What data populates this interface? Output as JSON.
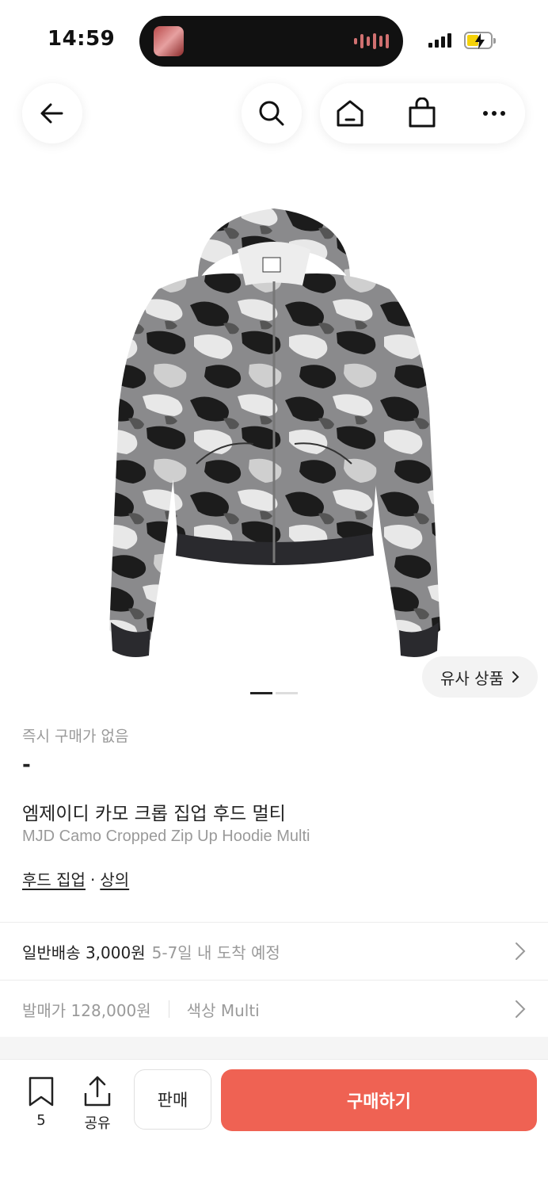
{
  "status_bar": {
    "time": "14:59"
  },
  "nav": {
    "back_icon": "arrow-left-icon",
    "search_icon": "search-icon",
    "home_icon": "home-icon",
    "bag_icon": "shopping-bag-icon",
    "more_icon": "more-horizontal-icon"
  },
  "gallery": {
    "similar_label": "유사 상품",
    "page_count": 2,
    "current_page": 1
  },
  "product": {
    "instant_purchase": "즉시 구매가 없음",
    "price": "-",
    "name_ko": "엠제이디 카모 크롭 집업 후드 멀티",
    "name_en": "MJD Camo Cropped Zip Up Hoodie Multi",
    "categories": [
      "후드 집업",
      "상의"
    ],
    "category_separator": "·"
  },
  "shipping": {
    "label": "일반배송 3,000원",
    "eta": "5-7일 내 도착 예정"
  },
  "details": {
    "release_price": "발매가 128,000원",
    "color": "색상 Multi"
  },
  "bottom_bar": {
    "bookmark_count": "5",
    "share_label": "공유",
    "sell_label": "판매",
    "buy_label": "구매하기"
  },
  "colors": {
    "buy_button": "#ef6253",
    "muted_text": "#9a9a9a"
  }
}
